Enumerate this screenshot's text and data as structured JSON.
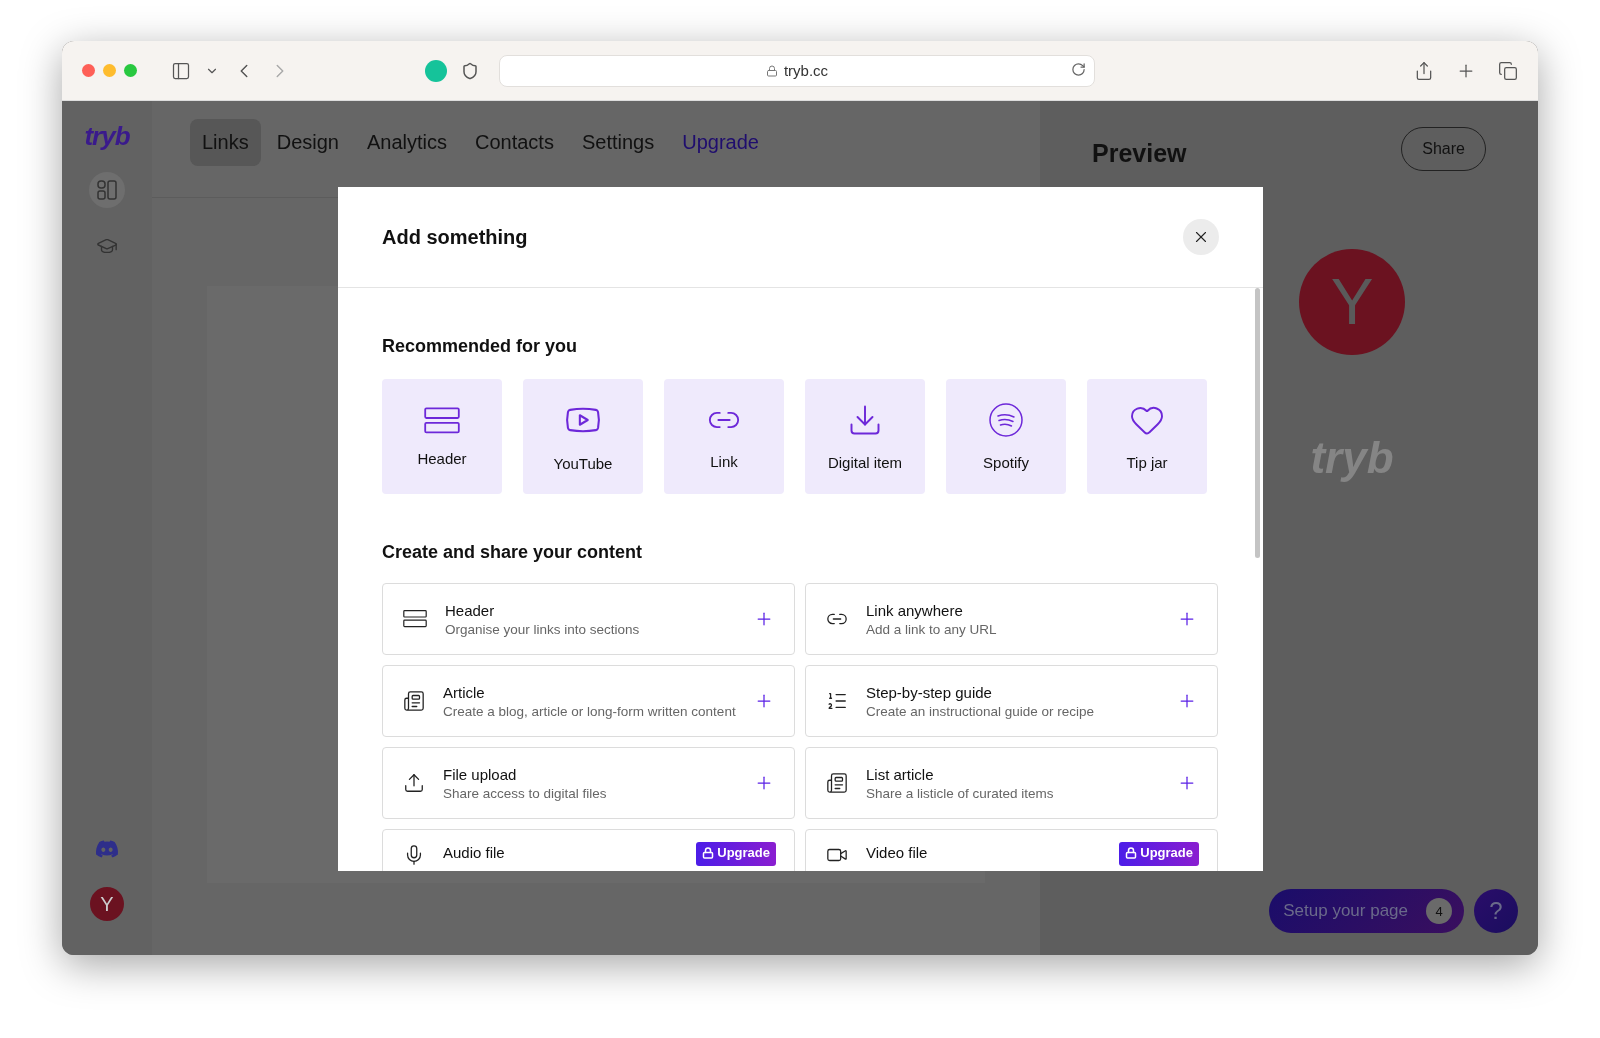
{
  "browser": {
    "url": "tryb.cc"
  },
  "sidebar": {
    "logo": "tryb",
    "avatar": "Y"
  },
  "nav": [
    {
      "label": "Links",
      "selected": true,
      "kind": "tab"
    },
    {
      "label": "Design",
      "selected": false,
      "kind": "tab"
    },
    {
      "label": "Analytics",
      "selected": false,
      "kind": "tab"
    },
    {
      "label": "Contacts",
      "selected": false,
      "kind": "tab"
    },
    {
      "label": "Settings",
      "selected": false,
      "kind": "tab"
    },
    {
      "label": "Upgrade",
      "selected": false,
      "kind": "upgrade"
    }
  ],
  "preview": {
    "title": "Preview",
    "share": "Share",
    "avatar": "Y",
    "logo": "tryb",
    "setup": {
      "label": "Setup your page",
      "count": "4"
    },
    "help": "?"
  },
  "modal": {
    "title": "Add something",
    "recommended_heading": "Recommended for you",
    "recommended": [
      {
        "label": "Header",
        "kind": "header"
      },
      {
        "label": "YouTube",
        "kind": "youtube"
      },
      {
        "label": "Link",
        "kind": "link"
      },
      {
        "label": "Digital item",
        "kind": "download"
      },
      {
        "label": "Spotify",
        "kind": "spotify"
      },
      {
        "label": "Tip jar",
        "kind": "heart"
      }
    ],
    "content_heading": "Create and share your content",
    "items": [
      {
        "title": "Header",
        "description": "Organise your links into sections",
        "kind": "header",
        "locked": false
      },
      {
        "title": "Link anywhere",
        "description": "Add a link to any URL",
        "kind": "link",
        "locked": false
      },
      {
        "title": "Article",
        "description": "Create a blog, article or long-form written content",
        "kind": "article",
        "locked": false
      },
      {
        "title": "Step-by-step guide",
        "description": "Create an instructional guide or recipe",
        "kind": "guide",
        "locked": false
      },
      {
        "title": "File upload",
        "description": "Share access to digital files",
        "kind": "upload",
        "locked": false
      },
      {
        "title": "List article",
        "description": "Share a listicle of curated items",
        "kind": "article",
        "locked": false
      },
      {
        "title": "Audio file",
        "kind": "audio",
        "locked": true,
        "badge": "Upgrade"
      },
      {
        "title": "Video file",
        "kind": "video",
        "locked": true,
        "badge": "Upgrade"
      }
    ]
  }
}
